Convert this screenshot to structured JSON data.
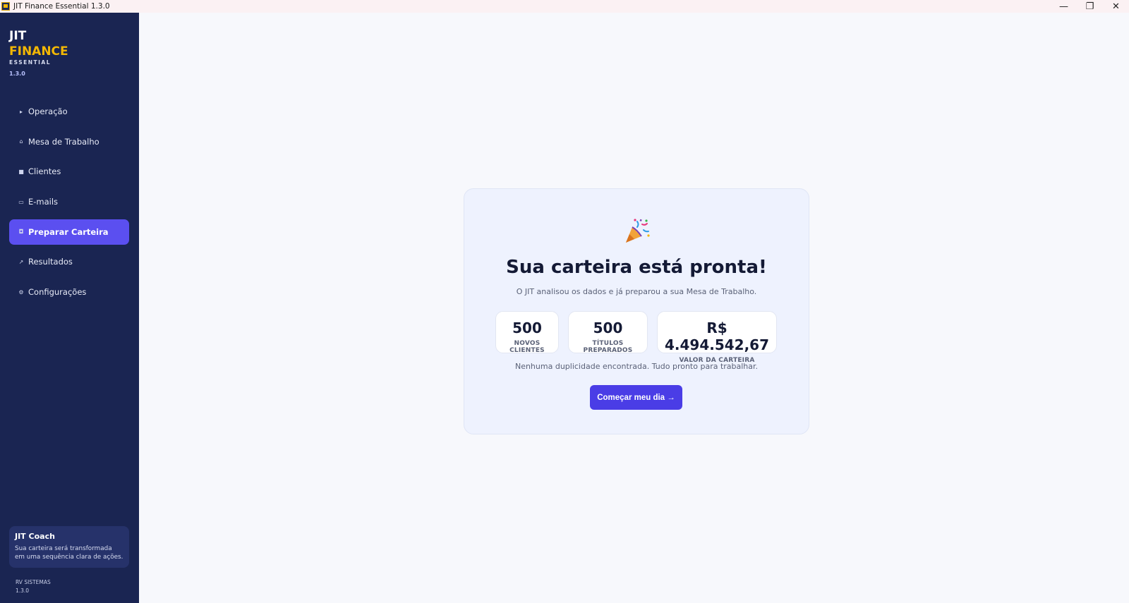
{
  "window": {
    "title": "JIT Finance Essential 1.3.0",
    "minimize_glyph": "—",
    "restore_glyph": "❐",
    "close_glyph": "✕"
  },
  "brand": {
    "line1": "JIT",
    "line2": "FINANCE",
    "line3": "ESSENTIAL",
    "version": "1.3.0",
    "accent_color": "#f2b705"
  },
  "sidebar": {
    "background": "#1a2552",
    "active_color": "#5b4ff0",
    "items": [
      {
        "label": "Operação",
        "icon": "play-icon",
        "glyph": "▸"
      },
      {
        "label": "Mesa de Trabalho",
        "icon": "home-icon",
        "glyph": "⌂"
      },
      {
        "label": "Clientes",
        "icon": "users-icon",
        "glyph": "■"
      },
      {
        "label": "E-mails",
        "icon": "mail-icon",
        "glyph": "▭"
      },
      {
        "label": "Preparar Carteira",
        "icon": "wallet-icon",
        "glyph": "◘",
        "active": true
      },
      {
        "label": "Resultados",
        "icon": "trend-icon",
        "glyph": "↗"
      },
      {
        "label": "Configurações",
        "icon": "gear-icon",
        "glyph": "⚙"
      }
    ]
  },
  "coach": {
    "title": "JIT Coach",
    "line1": "Sua carteira será transformada",
    "line2": "em uma sequência clara de ações."
  },
  "footer": {
    "company": "RV SISTEMAS",
    "version": "1.3.0"
  },
  "main": {
    "icon": "party-popper-icon",
    "headline": "Sua carteira está pronta!",
    "subtext": "O JIT analisou os dados e já preparou a sua Mesa de Trabalho.",
    "stats": [
      {
        "value": "500",
        "label": "NOVOS CLIENTES"
      },
      {
        "value": "500",
        "label": "TÍTULOS PREPARADOS"
      },
      {
        "value": "R$ 4.494.542,67",
        "label": "VALOR DA CARTEIRA"
      }
    ],
    "note": "Nenhuma duplicidade encontrada. Tudo pronto para trabalhar.",
    "cta_label": "Começar meu dia  →",
    "cta_color": "#4a3de6"
  }
}
